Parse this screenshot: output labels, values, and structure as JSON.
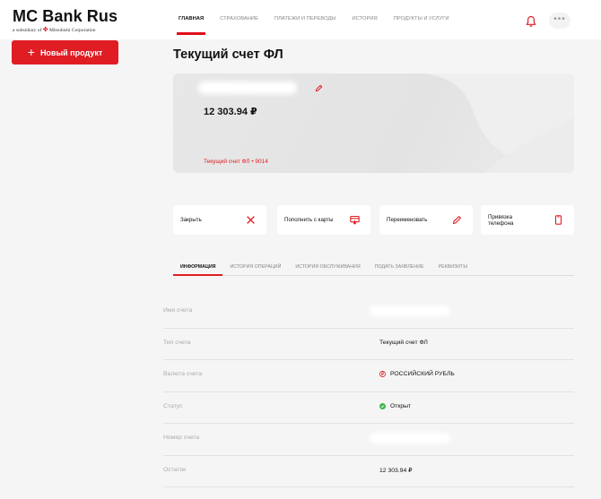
{
  "brand": {
    "title": "MC Bank Rus",
    "subtitle_prefix": "a subsidiary of",
    "subtitle_company": "Mitsubishi Corporation"
  },
  "nav": {
    "items": [
      {
        "label": "ГЛАВНАЯ",
        "active": true
      },
      {
        "label": "СТРАХОВАНИЕ",
        "active": false
      },
      {
        "label": "ПЛАТЕЖИ И ПЕРЕВОДЫ",
        "active": false
      },
      {
        "label": "ИСТОРИЯ",
        "active": false
      },
      {
        "label": "ПРОДУКТЫ И УСЛУГИ",
        "active": false
      }
    ],
    "more": "•••"
  },
  "sidebar": {
    "new_product_label": "Новый продукт",
    "new_product_plus": "+"
  },
  "page": {
    "title": "Текущий счет ФЛ"
  },
  "card": {
    "amount": "12 303.94 ₽",
    "label": "Текущий счет ФЛ • 9014"
  },
  "actions": [
    {
      "label": "Закрыть",
      "icon": "close-icon"
    },
    {
      "label": "Пополнить с карты",
      "icon": "card-topup-icon"
    },
    {
      "label": "Переименовать",
      "icon": "pencil-icon"
    },
    {
      "label": "Привязка телефона",
      "icon": "phone-icon"
    }
  ],
  "tabs": [
    {
      "label": "ИНФОРМАЦИЯ",
      "active": true
    },
    {
      "label": "ИСТОРИЯ ОПЕРАЦИЙ",
      "active": false
    },
    {
      "label": "ИСТОРИЯ ОБСЛУЖИВАНИЯ",
      "active": false
    },
    {
      "label": "ПОДАТЬ ЗАЯВЛЕНИЕ",
      "active": false
    },
    {
      "label": "РЕКВИЗИТЫ",
      "active": false
    }
  ],
  "info": {
    "rows": [
      {
        "label": "Имя счета",
        "value": ""
      },
      {
        "label": "Тип счета",
        "value": "Текущий счет ФЛ"
      },
      {
        "label": "Валюта счета",
        "value": "РОССИЙСКИЙ РУБЛЬ"
      },
      {
        "label": "Статус",
        "value": "Открыт"
      },
      {
        "label": "Номер счета",
        "value": ""
      },
      {
        "label": "Остаток",
        "value": "12 303.94 ₽"
      }
    ]
  },
  "colors": {
    "accent": "#e01d23",
    "success": "#3bb54a"
  }
}
